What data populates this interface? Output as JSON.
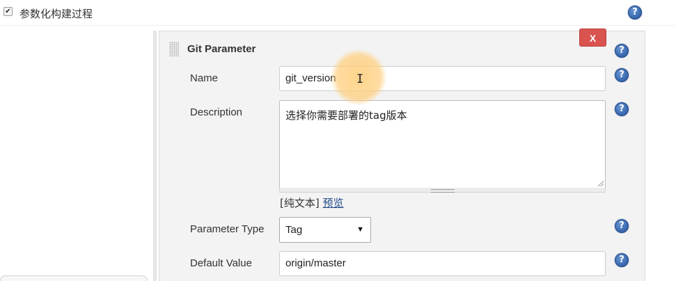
{
  "top": {
    "checkbox_mark": "✔",
    "label": "参数化构建过程",
    "help_glyph": "?"
  },
  "section": {
    "title": "Git Parameter",
    "delete_label": "X"
  },
  "fields": {
    "name": {
      "label": "Name",
      "value": "git_version"
    },
    "description": {
      "label": "Description",
      "value": "选择你需要部署的tag版本",
      "format_text": "[纯文本]",
      "preview_link": "预览"
    },
    "parameter_type": {
      "label": "Parameter Type",
      "selected": "Tag"
    },
    "default_value": {
      "label": "Default Value",
      "value": "origin/master"
    }
  },
  "colors": {
    "delete_button": "#d9534f",
    "help_icon": "#3f6fb6",
    "link": "#204a87",
    "panel_bg": "#f3f3f3"
  },
  "icons": {
    "help": "question-circle-icon",
    "delete": "close-icon",
    "dropdown": "chevron-down-icon",
    "drag_handle": "drag-handle-icon",
    "text_cursor": "i-beam-cursor-icon"
  }
}
